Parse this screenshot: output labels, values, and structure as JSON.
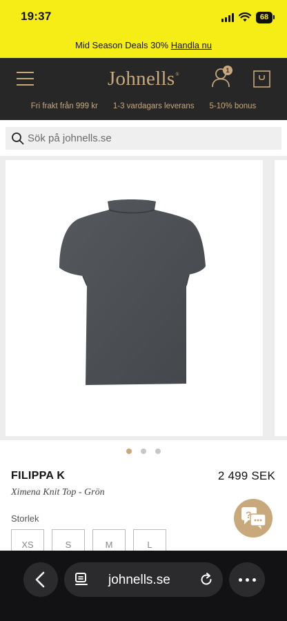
{
  "status_bar": {
    "time": "19:37",
    "battery": "68"
  },
  "promo": {
    "text": "Mid Season Deals 30% ",
    "link": "Handla nu"
  },
  "header": {
    "logo": "Johnells",
    "logo_mark": "®",
    "user_badge": "1",
    "usps": [
      "Fri frakt från 999 kr",
      "1-3 vardagars leverans",
      "5-10% bonus"
    ]
  },
  "search": {
    "placeholder": "Sök på johnells.se"
  },
  "gallery": {
    "slide_count": 3,
    "active_index": 0
  },
  "product": {
    "brand": "FILIPPA K",
    "price": "2 499 SEK",
    "name": "Ximena Knit Top - Grön",
    "size_label": "Storlek",
    "sizes": [
      "XS",
      "S",
      "M",
      "L"
    ]
  },
  "browser": {
    "url": "johnells.se"
  },
  "colors": {
    "promo_yellow": "#f6ec16",
    "header_dark": "#272728",
    "accent_gold": "#c9a97c",
    "garment_gray": "#4b4f53"
  }
}
